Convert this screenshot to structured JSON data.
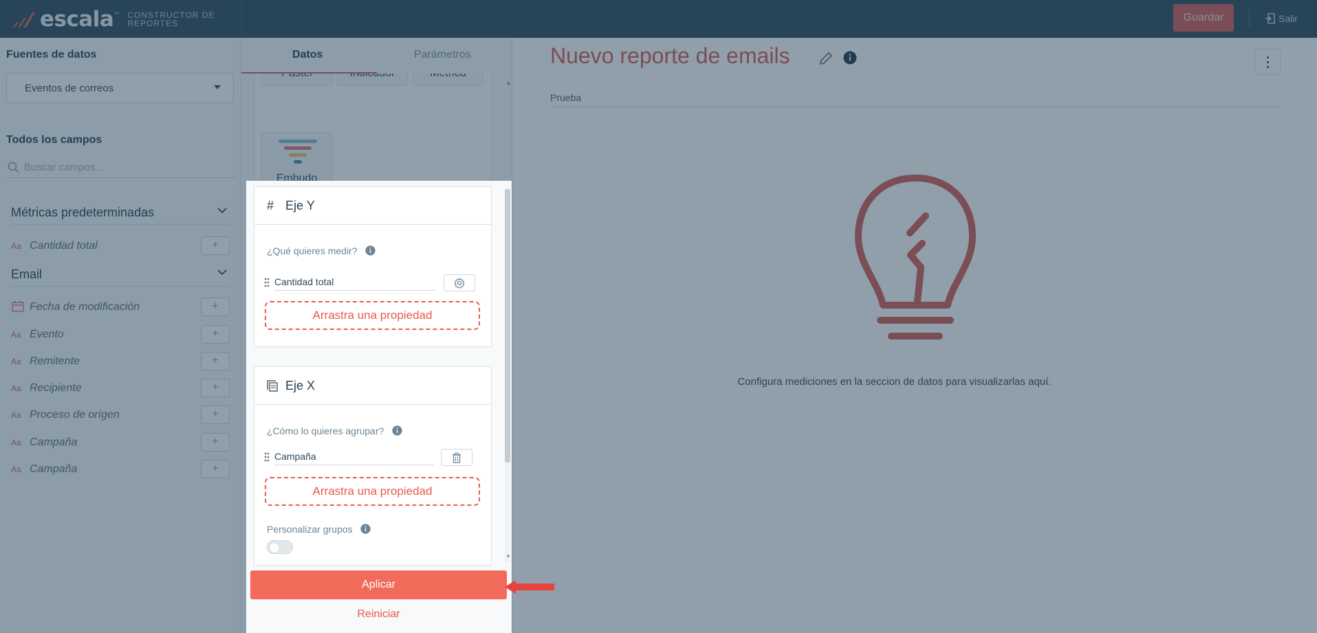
{
  "app": {
    "brand": "escala",
    "brand_tm": "™",
    "subtitle_line1": "CONSTRUCTOR DE",
    "subtitle_line2": "REPORTES",
    "save_label": "Guardar",
    "exit_label": "Salir"
  },
  "sidebar": {
    "sources_title": "Fuentes de datos",
    "source_selected": "Eventos de correos",
    "all_fields_title": "Todos los campos",
    "search_placeholder": "Buscar campos...",
    "sections": [
      {
        "label": "Métricas predeterminadas",
        "fields": [
          {
            "icon": "Aa",
            "name": "Cantidad total"
          }
        ]
      },
      {
        "label": "Email",
        "fields": [
          {
            "icon": "calendar-icon",
            "name": "Fecha de modificación"
          },
          {
            "icon": "Aa",
            "name": "Evento"
          },
          {
            "icon": "Aa",
            "name": "Remitente"
          },
          {
            "icon": "Aa",
            "name": "Recipiente"
          },
          {
            "icon": "Aa",
            "name": "Proceso de orígen"
          },
          {
            "icon": "Aa",
            "name": "Campaña"
          },
          {
            "icon": "Aa",
            "name": "Campaña"
          }
        ]
      }
    ],
    "add_label": "+"
  },
  "panel": {
    "tabs": [
      "Datos",
      "Parámetros"
    ],
    "chart_types": [
      "Pastel",
      "Indicador",
      "Métrica",
      "Embudo"
    ],
    "y_axis": {
      "title": "Eje Y",
      "icon": "#",
      "question": "¿Qué quieres medir?",
      "property": "Cantidad total",
      "dropzone": "Arrastra una propiedad"
    },
    "x_axis": {
      "title": "Eje X",
      "question": "¿Cómo lo quieres agrupar?",
      "property": "Campaña",
      "dropzone": "Arrastra una propiedad",
      "custom_groups_label": "Personalizar grupos",
      "custom_groups_enabled": false
    },
    "apply_label": "Aplicar",
    "reset_label": "Reiniciar"
  },
  "report": {
    "title": "Nuevo reporte de emails",
    "subtitle": "Prueba",
    "empty_message": "Configura mediciones en la seccion de datos para visualizarlas aquí."
  },
  "colors": {
    "topbar": "#2e495b",
    "accent": "#f26a5a",
    "title": "#d45a57",
    "overlay": "rgba(33,63,86,0.5)"
  }
}
